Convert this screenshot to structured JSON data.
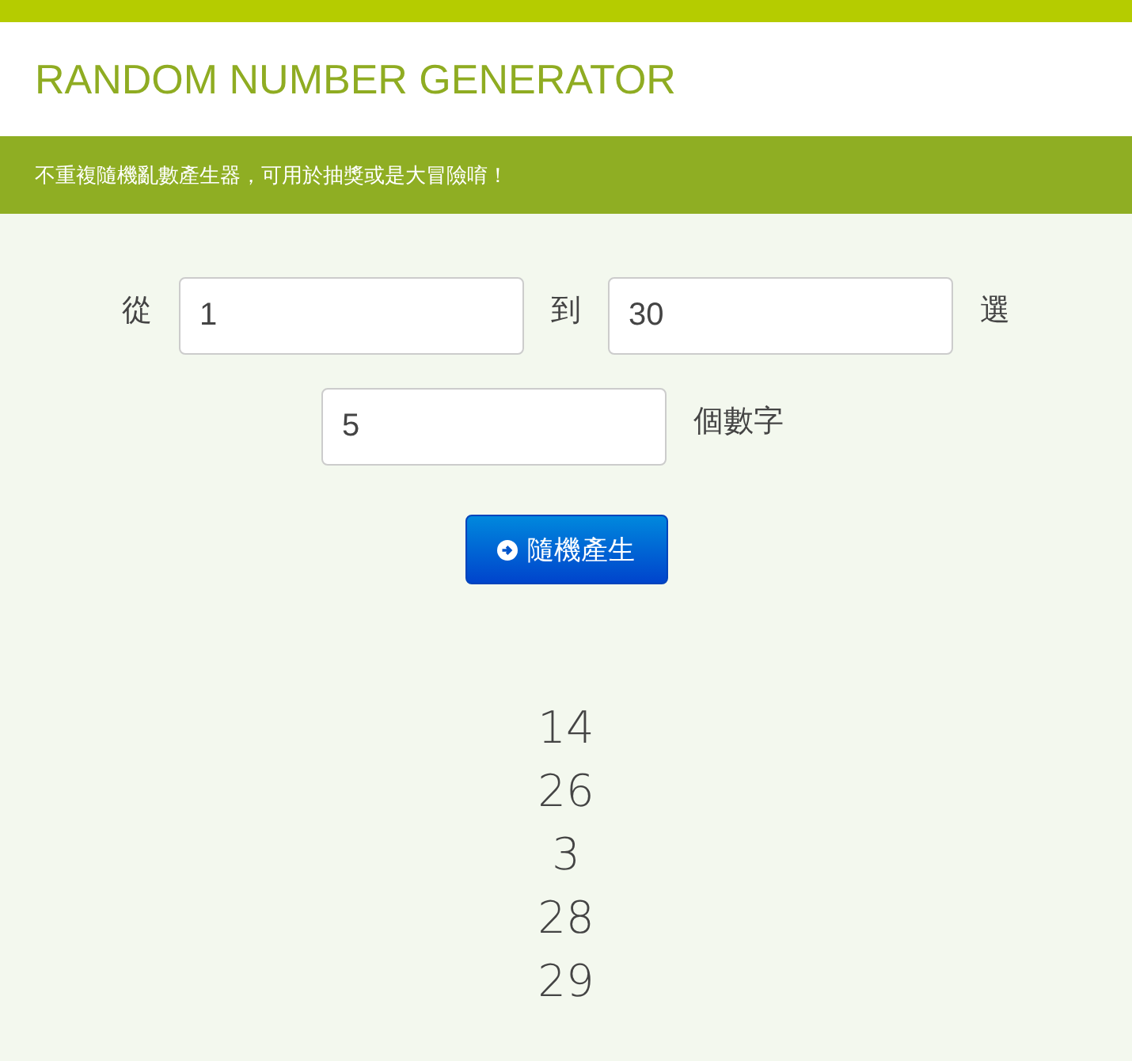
{
  "header": {
    "title": "RANDOM NUMBER GENERATOR"
  },
  "banner": {
    "text": "不重複隨機亂數產生器，可用於抽獎或是大冒險唷！"
  },
  "form": {
    "from_label": "從",
    "from_value": "1",
    "to_label": "到",
    "to_value": "30",
    "pick_label": "選",
    "count_value": "5",
    "count_label": "個數字"
  },
  "button": {
    "label": "隨機產生"
  },
  "results": [
    "14",
    "26",
    "3",
    "28",
    "29"
  ]
}
